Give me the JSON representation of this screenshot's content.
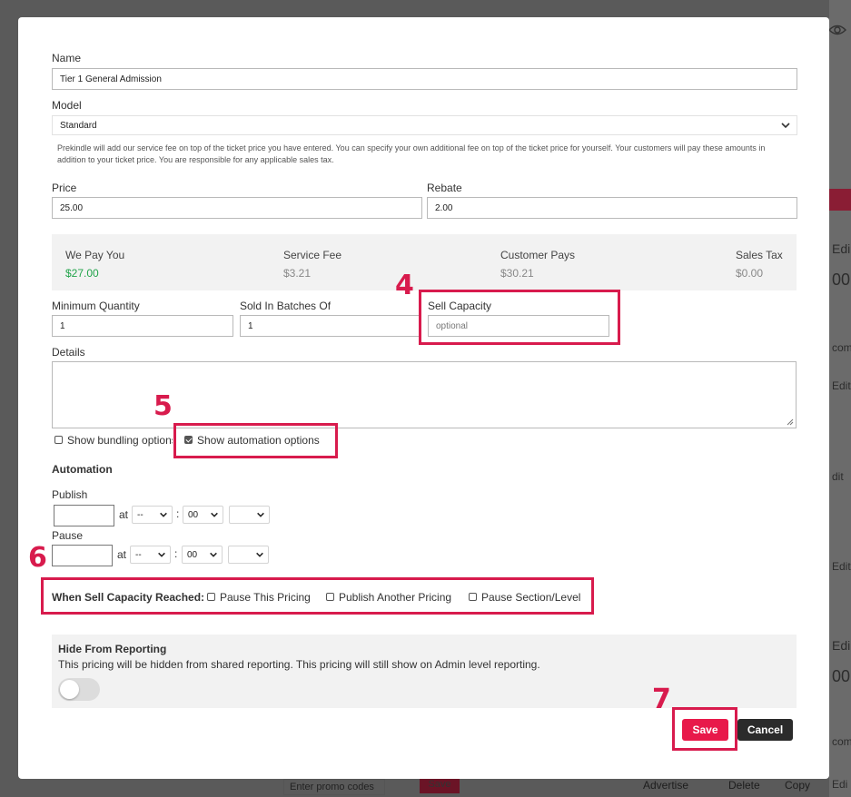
{
  "background": {
    "right_edge_texts": [
      "Edi",
      "00",
      "Edit",
      "com",
      "dit",
      "Edit",
      "Edi",
      "00",
      "com",
      "Edi"
    ],
    "promo_placeholder": "Enter promo codes",
    "promo_save": "Save",
    "bottom_links": [
      "Advertise",
      "Delete",
      "Copy"
    ]
  },
  "form": {
    "name_label": "Name",
    "name_value": "Tier 1 General Admission",
    "model_label": "Model",
    "model_value": "Standard",
    "model_info": "Prekindle will add our service fee on top of the ticket price you have entered. You can specify your own additional fee on top of the ticket price for yourself. Your customers will pay these amounts in addition to your ticket price. You are responsible for any applicable sales tax.",
    "price_label": "Price",
    "price_value": "25.00",
    "rebate_label": "Rebate",
    "rebate_value": "2.00",
    "summary": {
      "we_pay_label": "We Pay You",
      "we_pay_value": "$27.00",
      "service_fee_label": "Service Fee",
      "service_fee_value": "$3.21",
      "customer_pays_label": "Customer Pays",
      "customer_pays_value": "$30.21",
      "sales_tax_label": "Sales Tax",
      "sales_tax_value": "$0.00"
    },
    "min_qty_label": "Minimum Quantity",
    "min_qty_value": "1",
    "batches_label": "Sold In Batches Of",
    "batches_value": "1",
    "sell_capacity_label": "Sell Capacity",
    "sell_capacity_placeholder": "optional",
    "details_label": "Details",
    "show_bundling_label": "Show bundling options",
    "show_automation_label": "Show automation options",
    "automation_heading": "Automation",
    "publish_label": "Publish",
    "pause_label": "Pause",
    "at_label": "at",
    "colon": ":",
    "hour_placeholder": "--",
    "minute_value": "00",
    "ampm_value": "",
    "when_capacity_label": "When Sell Capacity Reached:",
    "pause_pricing_label": "Pause This Pricing",
    "publish_another_label": "Publish Another Pricing",
    "pause_section_label": "Pause Section/Level",
    "hide_reporting_title": "Hide From Reporting",
    "hide_reporting_desc": "This pricing will be hidden from shared reporting. This pricing will still show on Admin level reporting.",
    "hide_reporting_enabled": false,
    "save_label": "Save",
    "cancel_label": "Cancel"
  },
  "annotations": {
    "step4": "4",
    "step5": "5",
    "step6": "6",
    "step7": "7",
    "highlight_color": "#d81b4d"
  },
  "colors": {
    "accent": "#e8194a",
    "positive": "#22a44b",
    "dark_button": "#2b2b2b"
  }
}
